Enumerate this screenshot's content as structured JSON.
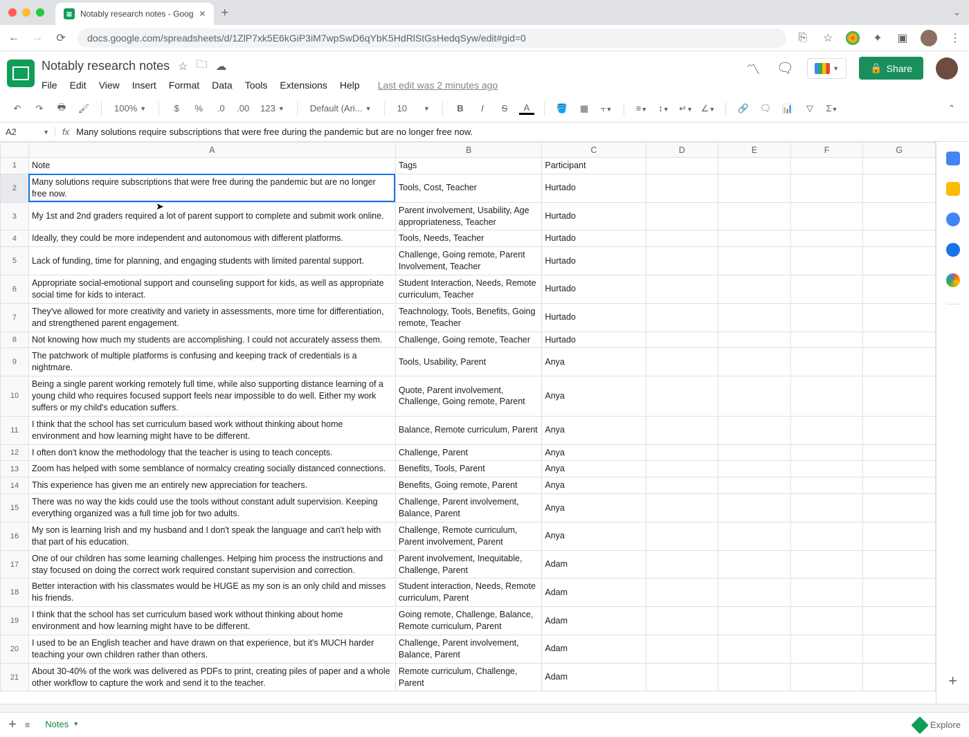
{
  "browser": {
    "tab_title": "Notably research notes - Goog",
    "url": "docs.google.com/spreadsheets/d/1ZlP7xk5E6kGiP3iM7wpSwD6qYbK5HdRlStGsHedqSyw/edit#gid=0"
  },
  "doc": {
    "title": "Notably research notes",
    "last_edit": "Last edit was 2 minutes ago"
  },
  "menus": [
    "File",
    "Edit",
    "View",
    "Insert",
    "Format",
    "Data",
    "Tools",
    "Extensions",
    "Help"
  ],
  "share_label": "Share",
  "toolbar": {
    "zoom": "100%",
    "number_fmt": "123",
    "font": "Default (Ari...",
    "size": "10"
  },
  "formula": {
    "name_box": "A2",
    "content": "Many solutions require subscriptions that were free during the pandemic but are no longer free now."
  },
  "columns": [
    "A",
    "B",
    "C",
    "D",
    "E",
    "F",
    "G"
  ],
  "headers": {
    "A": "Note",
    "B": "Tags",
    "C": "Participant"
  },
  "rows": [
    {
      "n": 2,
      "note": "Many solutions require subscriptions that were free during the pandemic but are no longer free now.",
      "tags": "Tools, Cost, Teacher",
      "participant": "Hurtado",
      "selected": true
    },
    {
      "n": 3,
      "note": "My 1st and 2nd graders required a lot of parent support to complete and submit work online.",
      "tags": "Parent involvement, Usability, Age appropriateness, Teacher",
      "participant": "Hurtado"
    },
    {
      "n": 4,
      "note": "Ideally, they could be more independent and autonomous with different platforms.",
      "tags": "Tools, Needs, Teacher",
      "participant": "Hurtado"
    },
    {
      "n": 5,
      "note": "Lack of funding, time for planning, and engaging students with limited parental support.",
      "tags": "Challenge, Going remote, Parent Involvement, Teacher",
      "participant": "Hurtado"
    },
    {
      "n": 6,
      "note": "Appropriate social-emotional support and counseling support for kids, as well as appropriate social time for kids to interact.",
      "tags": "Student Interaction, Needs, Remote curriculum, Teacher",
      "participant": "Hurtado"
    },
    {
      "n": 7,
      "note": "They've allowed for more creativity and variety in assessments, more time for differentiation, and strengthened parent engagement.",
      "tags": "Teachnology, Tools, Benefits, Going remote, Teacher",
      "participant": "Hurtado"
    },
    {
      "n": 8,
      "note": "Not knowing how much my students are accomplishing. I could not accurately assess them.",
      "tags": "Challenge, Going remote, Teacher",
      "participant": "Hurtado"
    },
    {
      "n": 9,
      "note": "The patchwork of multiple platforms is confusing and keeping track of credentials is a nightmare.",
      "tags": "Tools, Usability, Parent",
      "participant": "Anya"
    },
    {
      "n": 10,
      "note": "Being a single parent working remotely full time, while also supporting distance learning of a young child who requires focused support feels near impossible to do well. Either my work suffers or my child's education suffers.",
      "tags": "Quote, Parent involvement, Challenge, Going remote, Parent",
      "participant": "Anya"
    },
    {
      "n": 11,
      "note": "I think that the school has set curriculum based work without thinking about home environment and how learning might have to be different.",
      "tags": "Balance, Remote curriculum, Parent",
      "participant": "Anya"
    },
    {
      "n": 12,
      "note": "I often don't know the methodology that the teacher is using to teach concepts.",
      "tags": "Challenge, Parent",
      "participant": "Anya"
    },
    {
      "n": 13,
      "note": "Zoom has helped with some semblance of normalcy creating socially distanced connections.",
      "tags": "Benefits, Tools, Parent",
      "participant": "Anya"
    },
    {
      "n": 14,
      "note": "This experience has given me an entirely new appreciation for teachers.",
      "tags": "Benefits, Going remote, Parent",
      "participant": "Anya"
    },
    {
      "n": 15,
      "note": "There was no way the kids could use the tools without constant adult supervision. Keeping everything organized was a full time job for two adults.",
      "tags": "Challenge, Parent involvement, Balance, Parent",
      "participant": "Anya"
    },
    {
      "n": 16,
      "note": "My son is learning Irish and my husband and I don't speak the language and can't help with that part of his education.",
      "tags": "Challenge, Remote curriculum, Parent involvement, Parent",
      "participant": "Anya"
    },
    {
      "n": 17,
      "note": "One of our children has some learning challenges. Helping him process the instructions and stay focused on doing the correct work required constant supervision and correction.",
      "tags": "Parent involvement, Inequitable, Challenge, Parent",
      "participant": "Adam"
    },
    {
      "n": 18,
      "note": "Better interaction with his classmates would be HUGE as my son is an only child and misses his friends.",
      "tags": "Student interaction, Needs, Remote curriculum, Parent",
      "participant": "Adam"
    },
    {
      "n": 19,
      "note": "I think that the school has set curriculum based work without thinking about home environment and how learning might have to be different.",
      "tags": "Going remote, Challenge, Balance, Remote curriculum, Parent",
      "participant": "Adam"
    },
    {
      "n": 20,
      "note": "I used to be an English teacher and have drawn on that experience, but it's MUCH harder teaching your own children rather than others.",
      "tags": "Challenge, Parent involvement, Balance, Parent",
      "participant": "Adam"
    },
    {
      "n": 21,
      "note": "About 30-40% of the work was delivered as PDFs to print, creating piles of paper and a whole other workflow to capture the work and send it to the teacher.",
      "tags": "Remote curriculum, Challenge, Parent",
      "participant": "Adam"
    }
  ],
  "sheet_tab": "Notes",
  "explore_label": "Explore"
}
